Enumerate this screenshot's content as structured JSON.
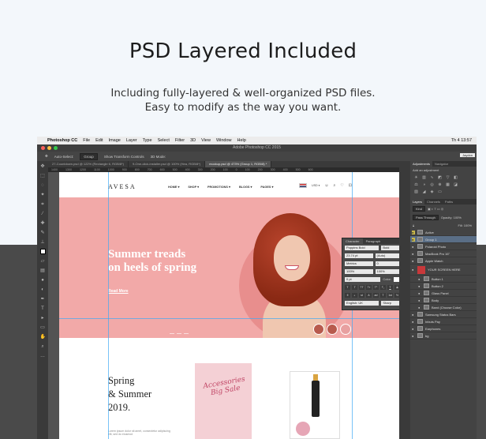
{
  "heading": "PSD Layered Included",
  "subline1": "Including fully-layered & well-organized PSD files.",
  "subline2": "Easy to modify as the way you want.",
  "photoshop": {
    "app_name": "Photoshop CC",
    "menu": [
      "File",
      "Edit",
      "Image",
      "Layer",
      "Type",
      "Select",
      "Filter",
      "3D",
      "View",
      "Window",
      "Help"
    ],
    "clock": "Th 4 13:57",
    "window_title": "Adobe Photoshop CC 2015",
    "options": {
      "auto_select": "Auto-Select:",
      "group": "Group",
      "transform": "Show Transform Controls",
      "mode": "3D Mode:"
    },
    "tabs": [
      "27-Countdown.psd @ 122% (Rectangle 6, RGB/8*)",
      "9-One-click-installer.psd @ 100% (Hea, RGB/8*)",
      "mockup.psd @ 473% (Group 1, RGB/8) *"
    ],
    "ruler": "1400 1300 1200 1100 1000 900 800 700 600 500 400 300 200 100 0 100 200 300 400 500 600",
    "workspace": "Jaydon",
    "panels": {
      "adjust_tabs": [
        "Adjustments",
        "Navigator"
      ],
      "adjust_title": "Add an adjustment",
      "layer_tabs": [
        "Layers",
        "Channels",
        "Paths"
      ],
      "kind": "Kind",
      "blend": "Pass Through",
      "opacity": "Opacity: 100%",
      "fill": "Fill: 100%",
      "layers": [
        {
          "name": "Active",
          "indent": false,
          "selected": false,
          "yellow": true
        },
        {
          "name": "Group 1",
          "indent": false,
          "selected": true,
          "yellow": true
        },
        {
          "name": "Polaroid Photo",
          "indent": false,
          "selected": false,
          "yellow": false
        },
        {
          "name": "MacBook Pro 16\"",
          "indent": false,
          "selected": false,
          "yellow": false
        },
        {
          "name": "Apple Watch",
          "indent": false,
          "selected": false,
          "yellow": false
        },
        {
          "name": "YOUR SCREEN HERE",
          "indent": false,
          "selected": false,
          "yellow": false,
          "big": true,
          "red": true
        },
        {
          "name": "Button 1",
          "indent": true,
          "selected": false,
          "yellow": false
        },
        {
          "name": "Button 2",
          "indent": true,
          "selected": false,
          "yellow": false
        },
        {
          "name": "Glass Panel",
          "indent": true,
          "selected": false,
          "yellow": false
        },
        {
          "name": "Body",
          "indent": true,
          "selected": false,
          "yellow": false
        },
        {
          "name": "Band (Choose Color)",
          "indent": true,
          "selected": false,
          "yellow": false
        },
        {
          "name": "Samsung Status Bars",
          "indent": false,
          "selected": false,
          "yellow": false
        },
        {
          "name": "Inbuts Pay",
          "indent": false,
          "selected": false,
          "yellow": false
        },
        {
          "name": "Earphones",
          "indent": false,
          "selected": false,
          "yellow": false
        },
        {
          "name": "bg",
          "indent": false,
          "selected": false,
          "yellow": false
        }
      ]
    },
    "character": {
      "tabs": [
        "Character",
        "Paragraph"
      ],
      "font": "Poppins Bold",
      "style": "Bold",
      "size": "23.74 pt",
      "leading": "(Auto)",
      "kerning": "Metrics",
      "tracking": "0",
      "scale_v": "100%",
      "scale_h": "100%",
      "baseline": "0 pt",
      "color_label": "Color:",
      "language": "English: UK",
      "aa": "Sharp"
    }
  },
  "site": {
    "logo": "AVESA",
    "nav": [
      "HOME ▾",
      "SHOP ▾",
      "PROMOTIONS ▾",
      "BLOGS ▾",
      "PAGES ▾"
    ],
    "currency": "USD ▾",
    "hero_title_1": "Summer treads",
    "hero_title_2": "on heels of spring",
    "hero_link": "Read More",
    "spring_1": "Spring",
    "spring_2": "& Summer",
    "spring_3": "2019.",
    "spring_small": "Lorem ipsum dolor sit amet, consectetur adipiscing elit, sed do eiusmod",
    "promo_1": "Accessories",
    "promo_2": "Big Sale"
  },
  "colors": {
    "hero": "#f2a9a8",
    "page_bg": "#f3f7fb",
    "dark_band": "#4a4a4a",
    "accent": "#c04565"
  }
}
